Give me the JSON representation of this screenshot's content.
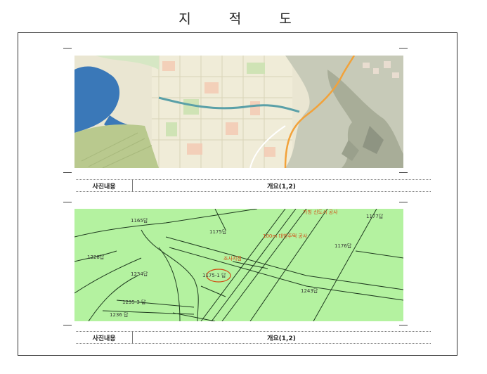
{
  "document": {
    "title": "지 적 도"
  },
  "panel_top": {
    "label": "사진내용",
    "value": "개요(1,2)"
  },
  "panel_bottom": {
    "label": "사진내용",
    "value": "개요(1,2)",
    "map_labels": {
      "p1": "1165답",
      "p2": "1175답",
      "p3": "1228답",
      "p4": "1234답",
      "p5": "1235-3 답",
      "p6": "1236 답",
      "p7": "1176답",
      "p8": "1243답",
      "p9": "1177답",
      "p10": "1175-1 답",
      "note1": "100m 대한주택 공사",
      "note2": "가칭 신도시 공사",
      "target": "조사지점"
    }
  },
  "colors": {
    "cadastral_bg": "#b4f2a0",
    "annotation": "#d14a12",
    "lake": "#3a78b8"
  }
}
